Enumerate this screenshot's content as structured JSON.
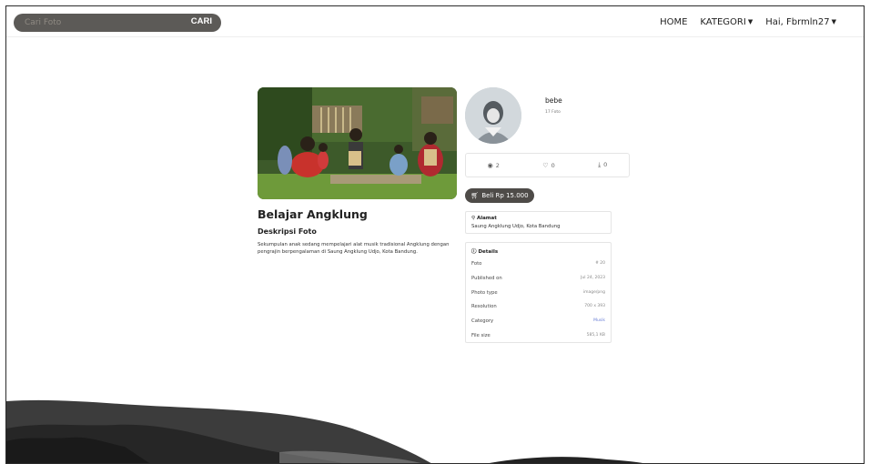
{
  "nav": {
    "search_placeholder": "Cari Foto",
    "search_button": "CARI",
    "links": [
      "HOME",
      "KATEGORI",
      "Hai, Fbrmln27"
    ]
  },
  "photo": {
    "title": "Belajar Angklung",
    "desc_heading": "Deskripsi Foto",
    "description": "Sekumpulan anak sedang mempelajari alat musik tradisional Angklung dengan pengrajin berpengalaman di Saung Angklung Udjo, Kota Bandung."
  },
  "profile": {
    "name": "bebe",
    "count": "17 Foto"
  },
  "stats": {
    "views": "2",
    "likes": "0",
    "downloads": "0"
  },
  "buy_label": "Beli Rp 15.000",
  "address": {
    "heading": "Alamat",
    "value": "Saung Angklung Udjo, Kota Bandung"
  },
  "details": {
    "heading": "Details",
    "rows": [
      {
        "k": "Foto",
        "v": "# 20"
      },
      {
        "k": "Published on",
        "v": "Jul 24, 2023"
      },
      {
        "k": "Photo type",
        "v": "image/png"
      },
      {
        "k": "Resolution",
        "v": "700 x 393"
      },
      {
        "k": "Category",
        "v": "Musik"
      },
      {
        "k": "File size",
        "v": "585,1 KB"
      }
    ]
  },
  "colors": {
    "search_bg": "#5c5a57",
    "buy_bg": "#4e4b48",
    "link": "#6b7fd6",
    "hill_dark": "#1f1f1f"
  }
}
